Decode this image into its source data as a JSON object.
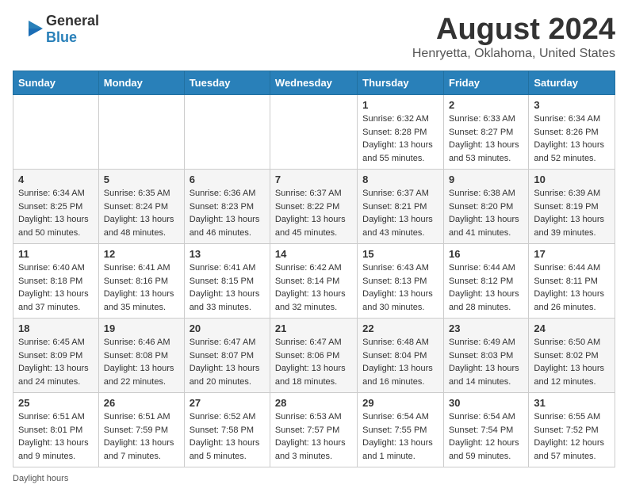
{
  "header": {
    "logo_line1": "General",
    "logo_line2": "Blue",
    "main_title": "August 2024",
    "sub_title": "Henryetta, Oklahoma, United States"
  },
  "footer": {
    "daylight_label": "Daylight hours"
  },
  "days_of_week": [
    "Sunday",
    "Monday",
    "Tuesday",
    "Wednesday",
    "Thursday",
    "Friday",
    "Saturday"
  ],
  "weeks": [
    [
      {
        "day": "",
        "sunrise": "",
        "sunset": "",
        "daylight": ""
      },
      {
        "day": "",
        "sunrise": "",
        "sunset": "",
        "daylight": ""
      },
      {
        "day": "",
        "sunrise": "",
        "sunset": "",
        "daylight": ""
      },
      {
        "day": "",
        "sunrise": "",
        "sunset": "",
        "daylight": ""
      },
      {
        "day": "1",
        "sunrise": "Sunrise: 6:32 AM",
        "sunset": "Sunset: 8:28 PM",
        "daylight": "Daylight: 13 hours and 55 minutes."
      },
      {
        "day": "2",
        "sunrise": "Sunrise: 6:33 AM",
        "sunset": "Sunset: 8:27 PM",
        "daylight": "Daylight: 13 hours and 53 minutes."
      },
      {
        "day": "3",
        "sunrise": "Sunrise: 6:34 AM",
        "sunset": "Sunset: 8:26 PM",
        "daylight": "Daylight: 13 hours and 52 minutes."
      }
    ],
    [
      {
        "day": "4",
        "sunrise": "Sunrise: 6:34 AM",
        "sunset": "Sunset: 8:25 PM",
        "daylight": "Daylight: 13 hours and 50 minutes."
      },
      {
        "day": "5",
        "sunrise": "Sunrise: 6:35 AM",
        "sunset": "Sunset: 8:24 PM",
        "daylight": "Daylight: 13 hours and 48 minutes."
      },
      {
        "day": "6",
        "sunrise": "Sunrise: 6:36 AM",
        "sunset": "Sunset: 8:23 PM",
        "daylight": "Daylight: 13 hours and 46 minutes."
      },
      {
        "day": "7",
        "sunrise": "Sunrise: 6:37 AM",
        "sunset": "Sunset: 8:22 PM",
        "daylight": "Daylight: 13 hours and 45 minutes."
      },
      {
        "day": "8",
        "sunrise": "Sunrise: 6:37 AM",
        "sunset": "Sunset: 8:21 PM",
        "daylight": "Daylight: 13 hours and 43 minutes."
      },
      {
        "day": "9",
        "sunrise": "Sunrise: 6:38 AM",
        "sunset": "Sunset: 8:20 PM",
        "daylight": "Daylight: 13 hours and 41 minutes."
      },
      {
        "day": "10",
        "sunrise": "Sunrise: 6:39 AM",
        "sunset": "Sunset: 8:19 PM",
        "daylight": "Daylight: 13 hours and 39 minutes."
      }
    ],
    [
      {
        "day": "11",
        "sunrise": "Sunrise: 6:40 AM",
        "sunset": "Sunset: 8:18 PM",
        "daylight": "Daylight: 13 hours and 37 minutes."
      },
      {
        "day": "12",
        "sunrise": "Sunrise: 6:41 AM",
        "sunset": "Sunset: 8:16 PM",
        "daylight": "Daylight: 13 hours and 35 minutes."
      },
      {
        "day": "13",
        "sunrise": "Sunrise: 6:41 AM",
        "sunset": "Sunset: 8:15 PM",
        "daylight": "Daylight: 13 hours and 33 minutes."
      },
      {
        "day": "14",
        "sunrise": "Sunrise: 6:42 AM",
        "sunset": "Sunset: 8:14 PM",
        "daylight": "Daylight: 13 hours and 32 minutes."
      },
      {
        "day": "15",
        "sunrise": "Sunrise: 6:43 AM",
        "sunset": "Sunset: 8:13 PM",
        "daylight": "Daylight: 13 hours and 30 minutes."
      },
      {
        "day": "16",
        "sunrise": "Sunrise: 6:44 AM",
        "sunset": "Sunset: 8:12 PM",
        "daylight": "Daylight: 13 hours and 28 minutes."
      },
      {
        "day": "17",
        "sunrise": "Sunrise: 6:44 AM",
        "sunset": "Sunset: 8:11 PM",
        "daylight": "Daylight: 13 hours and 26 minutes."
      }
    ],
    [
      {
        "day": "18",
        "sunrise": "Sunrise: 6:45 AM",
        "sunset": "Sunset: 8:09 PM",
        "daylight": "Daylight: 13 hours and 24 minutes."
      },
      {
        "day": "19",
        "sunrise": "Sunrise: 6:46 AM",
        "sunset": "Sunset: 8:08 PM",
        "daylight": "Daylight: 13 hours and 22 minutes."
      },
      {
        "day": "20",
        "sunrise": "Sunrise: 6:47 AM",
        "sunset": "Sunset: 8:07 PM",
        "daylight": "Daylight: 13 hours and 20 minutes."
      },
      {
        "day": "21",
        "sunrise": "Sunrise: 6:47 AM",
        "sunset": "Sunset: 8:06 PM",
        "daylight": "Daylight: 13 hours and 18 minutes."
      },
      {
        "day": "22",
        "sunrise": "Sunrise: 6:48 AM",
        "sunset": "Sunset: 8:04 PM",
        "daylight": "Daylight: 13 hours and 16 minutes."
      },
      {
        "day": "23",
        "sunrise": "Sunrise: 6:49 AM",
        "sunset": "Sunset: 8:03 PM",
        "daylight": "Daylight: 13 hours and 14 minutes."
      },
      {
        "day": "24",
        "sunrise": "Sunrise: 6:50 AM",
        "sunset": "Sunset: 8:02 PM",
        "daylight": "Daylight: 13 hours and 12 minutes."
      }
    ],
    [
      {
        "day": "25",
        "sunrise": "Sunrise: 6:51 AM",
        "sunset": "Sunset: 8:01 PM",
        "daylight": "Daylight: 13 hours and 9 minutes."
      },
      {
        "day": "26",
        "sunrise": "Sunrise: 6:51 AM",
        "sunset": "Sunset: 7:59 PM",
        "daylight": "Daylight: 13 hours and 7 minutes."
      },
      {
        "day": "27",
        "sunrise": "Sunrise: 6:52 AM",
        "sunset": "Sunset: 7:58 PM",
        "daylight": "Daylight: 13 hours and 5 minutes."
      },
      {
        "day": "28",
        "sunrise": "Sunrise: 6:53 AM",
        "sunset": "Sunset: 7:57 PM",
        "daylight": "Daylight: 13 hours and 3 minutes."
      },
      {
        "day": "29",
        "sunrise": "Sunrise: 6:54 AM",
        "sunset": "Sunset: 7:55 PM",
        "daylight": "Daylight: 13 hours and 1 minute."
      },
      {
        "day": "30",
        "sunrise": "Sunrise: 6:54 AM",
        "sunset": "Sunset: 7:54 PM",
        "daylight": "Daylight: 12 hours and 59 minutes."
      },
      {
        "day": "31",
        "sunrise": "Sunrise: 6:55 AM",
        "sunset": "Sunset: 7:52 PM",
        "daylight": "Daylight: 12 hours and 57 minutes."
      }
    ]
  ]
}
